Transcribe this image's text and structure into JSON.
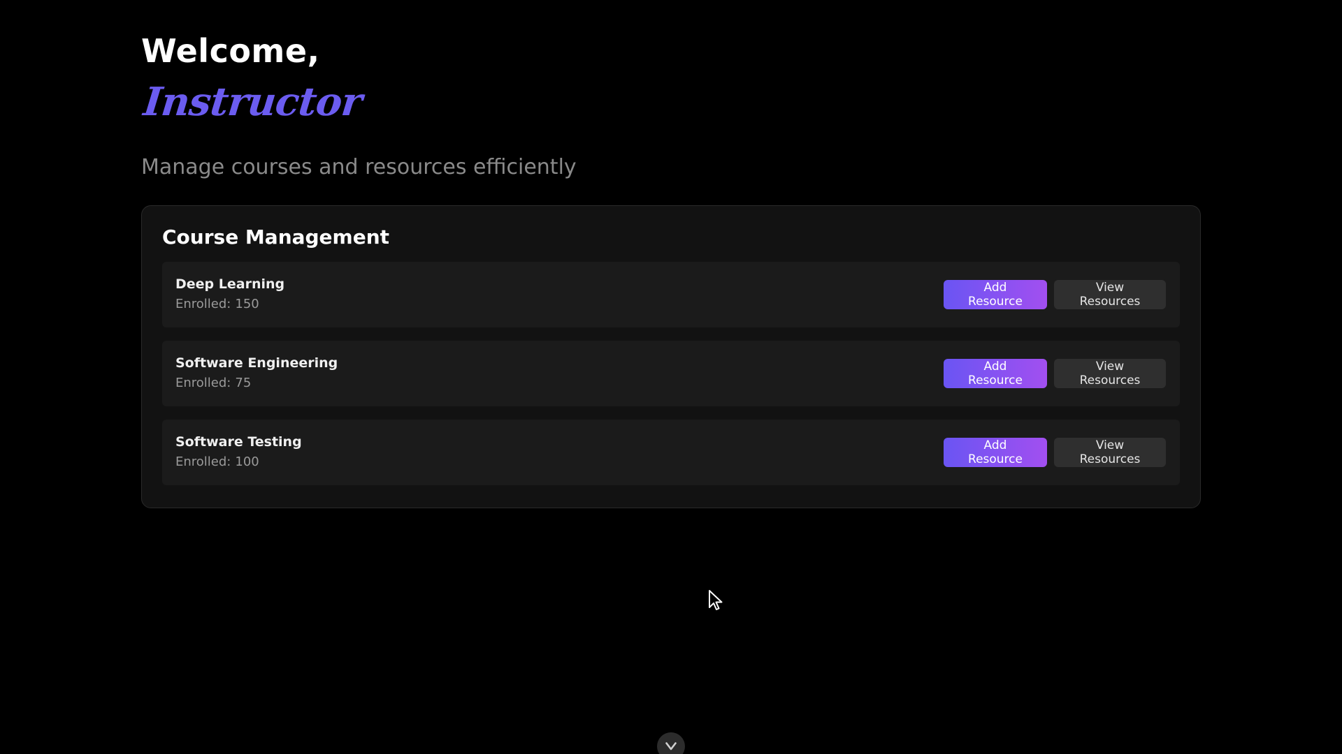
{
  "hero": {
    "welcome": "Welcome,",
    "role": "Instructor",
    "subtitle": "Manage courses and resources efficiently"
  },
  "course_management": {
    "title": "Course Management",
    "enrolled_label": "Enrolled:",
    "add_label": "Add Resource",
    "view_label": "View Resources",
    "courses": [
      {
        "name": "Deep Learning",
        "enrolled": "150"
      },
      {
        "name": "Software Engineering",
        "enrolled": "75"
      },
      {
        "name": "Software Testing",
        "enrolled": "100"
      }
    ]
  },
  "icons": {
    "scroll": "chevron-down-icon",
    "cursor": "mouse-cursor-icon"
  },
  "colors": {
    "background": "#000000",
    "accent": "#6b5cf0",
    "button_gradient_start": "#6a55f3",
    "button_gradient_end": "#a24ff0"
  }
}
